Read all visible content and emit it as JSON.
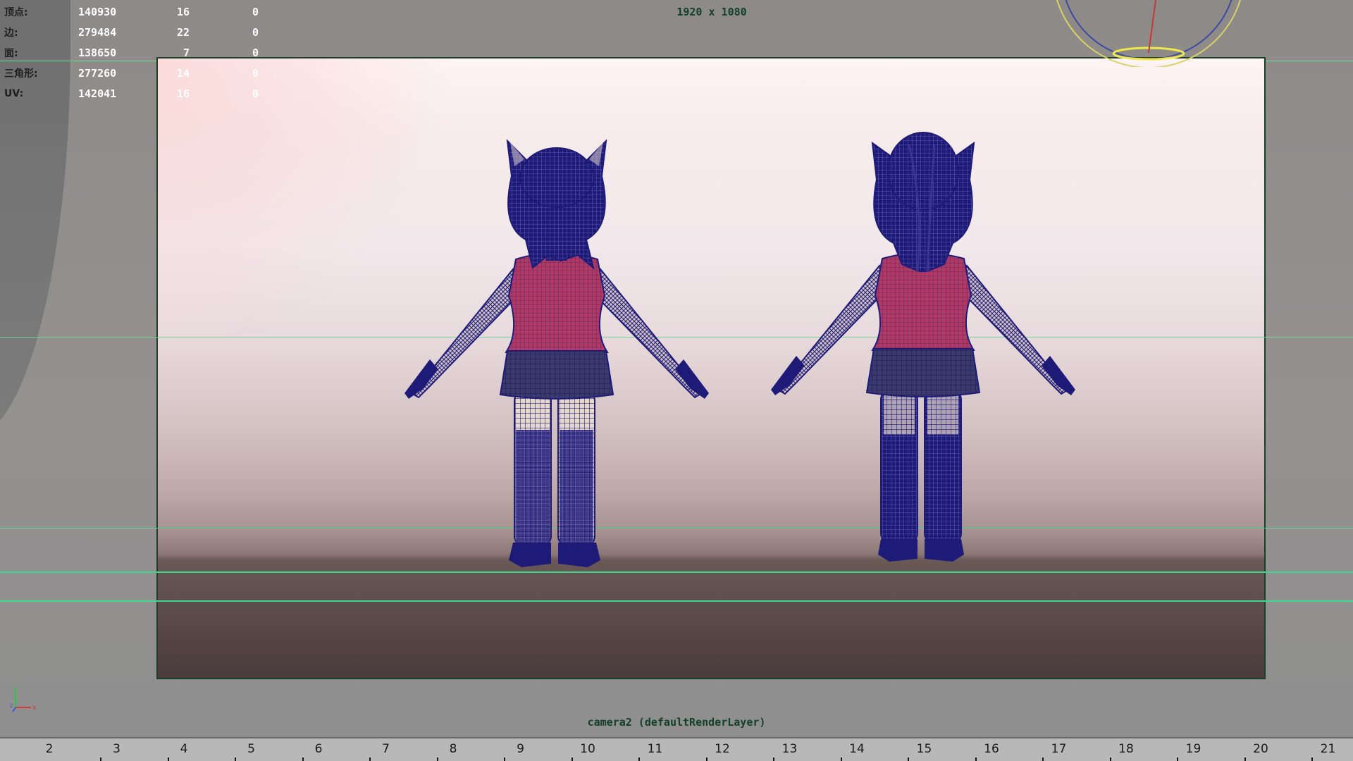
{
  "stats": [
    {
      "label": "顶点:",
      "c1": "140930",
      "c2": "16",
      "c3": "0"
    },
    {
      "label": "边:",
      "c1": "279484",
      "c2": "22",
      "c3": "0"
    },
    {
      "label": "面:",
      "c1": "138650",
      "c2": "7",
      "c3": "0"
    },
    {
      "label": "三角形:",
      "c1": "277260",
      "c2": "14",
      "c3": "0"
    },
    {
      "label": "UV:",
      "c1": "142041",
      "c2": "16",
      "c3": "0"
    }
  ],
  "resolution_label": "1920 x 1080",
  "camera_label": "camera2 (defaultRenderLayer)",
  "timeline": {
    "ticks": [
      "2",
      "3",
      "4",
      "5",
      "6",
      "7",
      "8",
      "9",
      "10",
      "11",
      "12",
      "13",
      "14",
      "15",
      "16",
      "17",
      "18",
      "19",
      "20",
      "21"
    ]
  },
  "axis_labels": {
    "y": "y",
    "x": "x",
    "z": "z"
  },
  "colors": {
    "wireframe": "#1c1670",
    "grid": "#3cd88a",
    "gate_border": "#1c3e28",
    "shirt": "#b03a66"
  },
  "icons": [
    "view-cube-gizmo-icon",
    "axis-indicator-icon"
  ]
}
